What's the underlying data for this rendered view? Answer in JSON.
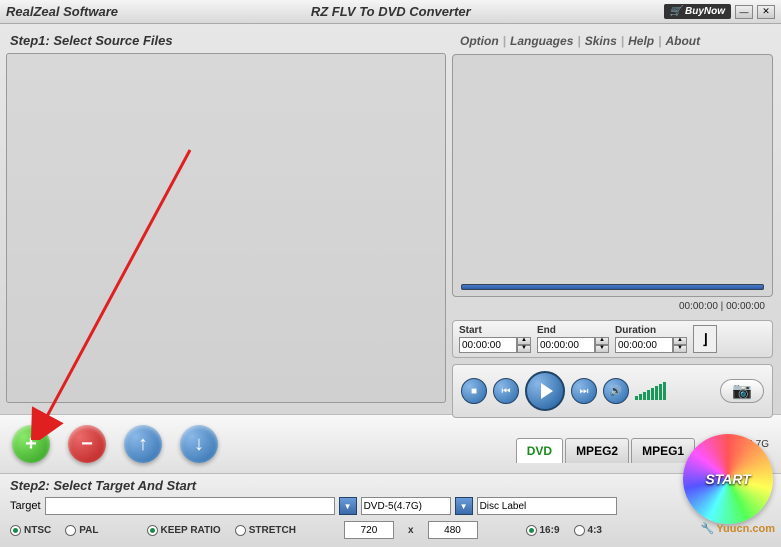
{
  "titlebar": {
    "brand": "RealZeal Software",
    "title": "RZ FLV To DVD Converter",
    "buynow": "BuyNow"
  },
  "menu": {
    "option": "Option",
    "languages": "Languages",
    "skins": "Skins",
    "help": "Help",
    "about": "About"
  },
  "step1": {
    "label": "Step1: Select Source Files"
  },
  "preview": {
    "time_left": "00:00:00",
    "time_right": "00:00:00"
  },
  "trim": {
    "start_label": "Start",
    "start_val": "00:00:00",
    "end_label": "End",
    "end_val": "00:00:00",
    "dur_label": "Duration",
    "dur_val": "00:00:00"
  },
  "tabs": {
    "dvd": "DVD",
    "mpeg2": "MPEG2",
    "mpeg1": "MPEG1"
  },
  "size": "0M / 4.7G",
  "step2": {
    "label": "Step2: Select Target And Start",
    "target_label": "Target",
    "preset": "DVD-5(4.7G)",
    "disc_label": "Disc Label"
  },
  "radios": {
    "ntsc": "NTSC",
    "pal": "PAL",
    "keep": "KEEP RATIO",
    "stretch": "STRETCH",
    "w": "720",
    "h": "480",
    "r169": "16:9",
    "r43": "4:3"
  },
  "start": "START",
  "watermark": "Yuucn.com"
}
